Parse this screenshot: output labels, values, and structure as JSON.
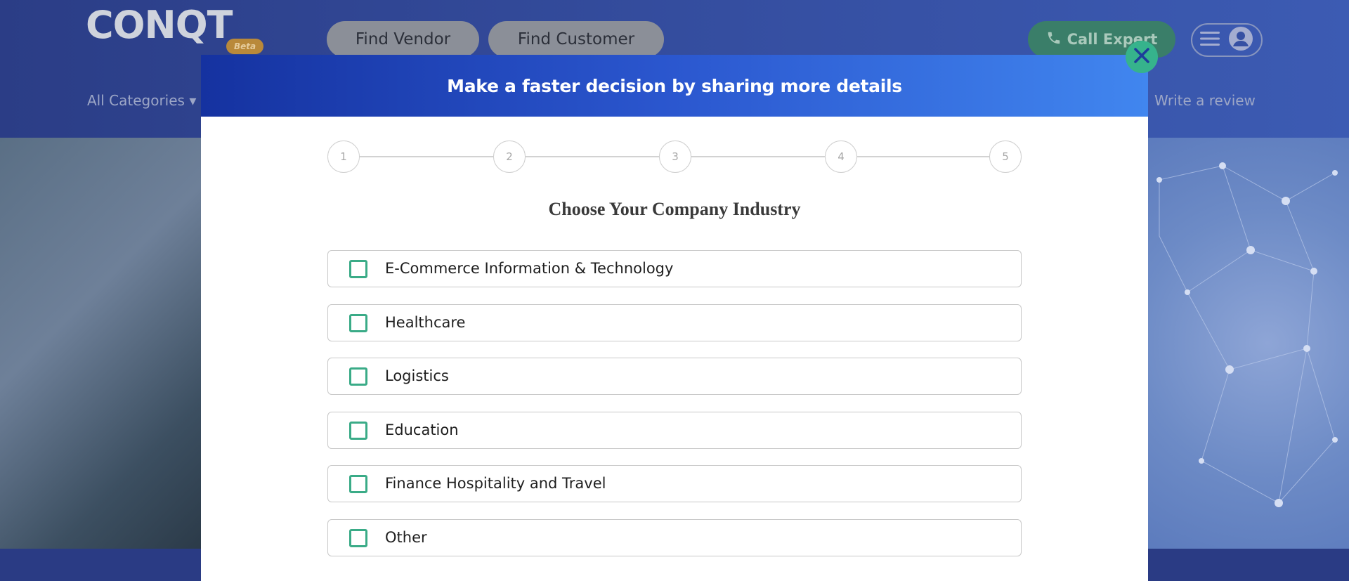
{
  "header": {
    "logo_text": "CONQT",
    "beta_label": "Beta",
    "find_vendor": "Find Vendor",
    "find_customer": "Find Customer",
    "call_expert": "Call Expert",
    "all_categories": "All Categories",
    "write_review": "Write a review"
  },
  "modal": {
    "title": "Make a faster decision by sharing more details",
    "steps": [
      "1",
      "2",
      "3",
      "4",
      "5"
    ],
    "question": "Choose Your Company Industry",
    "options": [
      "E-Commerce Information & Technology",
      "Healthcare",
      "Logistics",
      "Education",
      "Finance Hospitality and Travel",
      "Other"
    ]
  },
  "colors": {
    "accent_green": "#3aab87",
    "modal_header_start": "#1532a0",
    "modal_header_end": "#4186ef"
  },
  "icons": [
    "phone-icon",
    "hamburger-icon",
    "user-icon",
    "close-icon",
    "magnifier-icon",
    "caret-down-icon"
  ]
}
